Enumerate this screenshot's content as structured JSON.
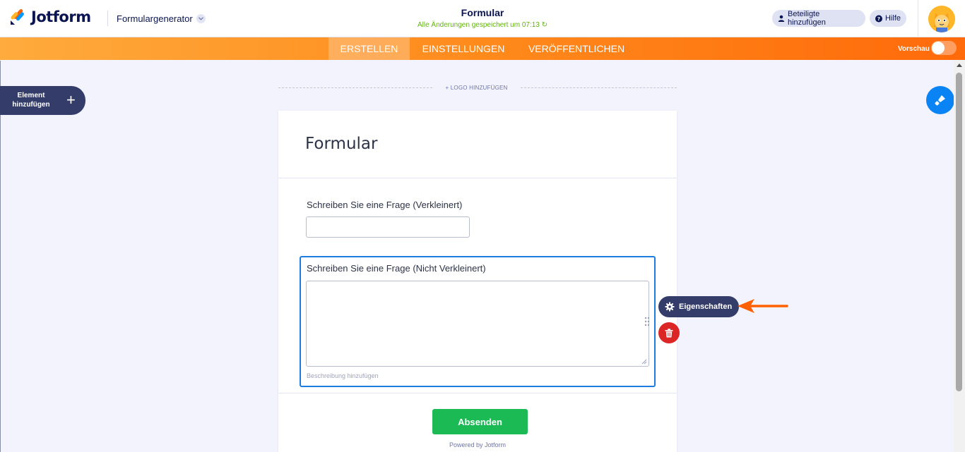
{
  "header": {
    "brand": "Jotform",
    "app_switcher_label": "Formulargenerator",
    "form_title": "Formular",
    "save_status": "Alle Änderungen gespeichert um 07:13 ↻",
    "add_collaborators_label": "Beteiligte hinzufügen",
    "help_label": "Hilfe"
  },
  "nav": {
    "tabs": [
      {
        "label": "ERSTELLEN",
        "active": true
      },
      {
        "label": "EINSTELLUNGEN",
        "active": false
      },
      {
        "label": "VERÖFFENTLICHEN",
        "active": false
      }
    ],
    "preview_label": "Vorschau",
    "preview_enabled": false
  },
  "sidebar": {
    "add_element_label": "Element hinzufügen"
  },
  "form": {
    "add_logo_label": "+ LOGO HINZUFÜGEN",
    "title": "Formular",
    "questions": [
      {
        "label": "Schreiben Sie eine Frage (Verkleinert)",
        "value": ""
      },
      {
        "label": "Schreiben Sie eine Frage (Nicht Verkleinert)",
        "value": "",
        "description_placeholder": "Beschreibung hinzufügen"
      }
    ],
    "submit_label": "Absenden",
    "powered_by": "Powered by Jotform"
  },
  "field_tools": {
    "properties_label": "Eigenschaften"
  },
  "colors": {
    "brand_navy": "#0a1551",
    "nav_orange": "#ff8a1c",
    "selection_blue": "#1d7ce0",
    "submit_green": "#1bba55",
    "delete_red": "#dc2626",
    "designer_blue": "#0a84f5",
    "save_green": "#64b210"
  }
}
